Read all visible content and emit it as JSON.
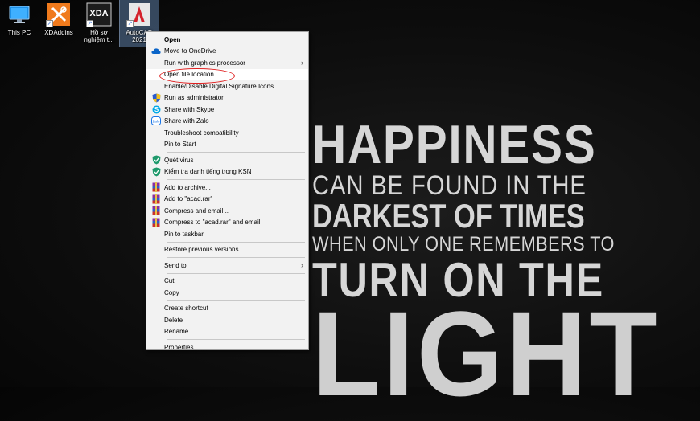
{
  "desktop": {
    "icons": [
      {
        "label_line1": "This PC",
        "label_line2": ""
      },
      {
        "label_line1": "XDAddins",
        "label_line2": ""
      },
      {
        "label_line1": "Hồ sơ",
        "label_line2": "nghiệm t...",
        "badge": "XDA"
      },
      {
        "label_line1": "AutoCAD",
        "label_line2": "2021",
        "badge": "A"
      }
    ]
  },
  "poster": {
    "line1": "HAPPINESS",
    "line2": "CAN BE FOUND IN THE",
    "line3": "DARKEST OF TIMES",
    "line4": "WHEN ONLY ONE REMEMBERS TO",
    "line5": "TURN ON THE",
    "line6": "LIGHT"
  },
  "context_menu": {
    "items": [
      {
        "label": "Open",
        "icon": "none",
        "bold": true
      },
      {
        "label": "Move to OneDrive",
        "icon": "onedrive-icon"
      },
      {
        "label": "Run with graphics processor",
        "icon": "none",
        "submenu": true
      },
      {
        "label": "Open file location",
        "icon": "none",
        "highlighted": true
      },
      {
        "label": "Enable/Disable Digital Signature Icons",
        "icon": "none"
      },
      {
        "label": "Run as administrator",
        "icon": "shield-icon"
      },
      {
        "label": "Share with Skype",
        "icon": "skype-icon"
      },
      {
        "label": "Share with Zalo",
        "icon": "zalo-icon"
      },
      {
        "label": "Troubleshoot compatibility",
        "icon": "none"
      },
      {
        "label": "Pin to Start",
        "icon": "none"
      },
      {
        "label": "Quét virus",
        "icon": "kaspersky-icon"
      },
      {
        "label": "Kiểm tra danh tiếng trong KSN",
        "icon": "kaspersky-icon"
      },
      {
        "label": "Add to archive...",
        "icon": "winrar-icon"
      },
      {
        "label": "Add to \"acad.rar\"",
        "icon": "winrar-icon"
      },
      {
        "label": "Compress and email...",
        "icon": "winrar-icon"
      },
      {
        "label": "Compress to \"acad.rar\" and email",
        "icon": "winrar-icon"
      },
      {
        "label": "Pin to taskbar",
        "icon": "none"
      },
      {
        "label": "Restore previous versions",
        "icon": "none"
      },
      {
        "label": "Send to",
        "icon": "none",
        "submenu": true
      },
      {
        "label": "Cut",
        "icon": "none"
      },
      {
        "label": "Copy",
        "icon": "none"
      },
      {
        "label": "Create shortcut",
        "icon": "none"
      },
      {
        "label": "Delete",
        "icon": "none"
      },
      {
        "label": "Rename",
        "icon": "none"
      },
      {
        "label": "Properties",
        "icon": "none"
      }
    ]
  },
  "colors": {
    "annotation": "#e02020",
    "menu_bg": "#f2f2f2",
    "selection": "#6e96c8"
  }
}
